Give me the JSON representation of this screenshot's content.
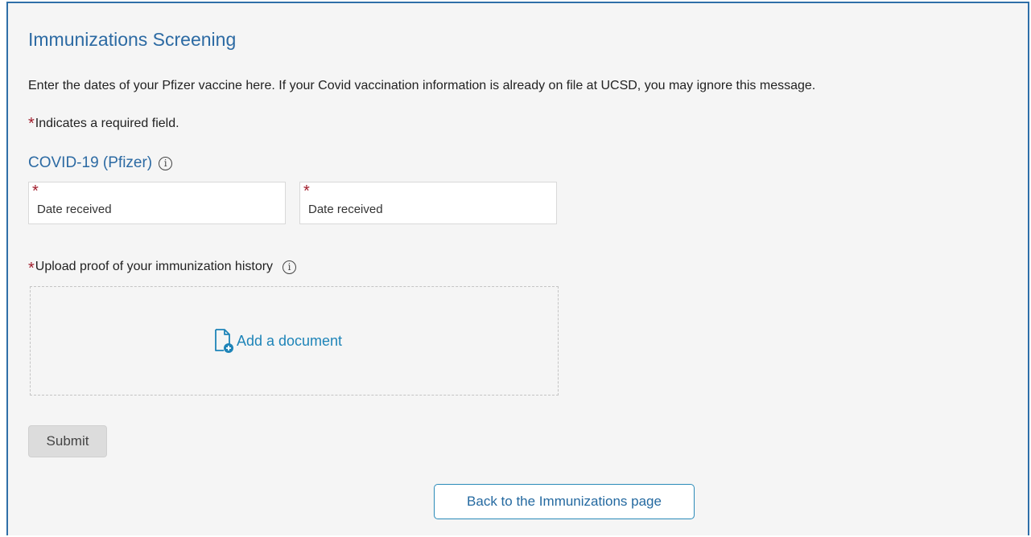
{
  "page": {
    "title": "Immunizations Screening",
    "intro": "Enter the dates of your Pfizer vaccine here. If your Covid vaccination information is already on file at UCSD, you may ignore this message.",
    "required_star": "*",
    "required_note": "Indicates a required field."
  },
  "vaccine": {
    "section_title": "COVID-19 (Pfizer)",
    "info_glyph": "i",
    "fields": [
      {
        "placeholder": "Date received",
        "value": ""
      },
      {
        "placeholder": "Date received",
        "value": ""
      }
    ]
  },
  "upload": {
    "label": "Upload proof of your immunization history",
    "add_document_label": "Add a document",
    "icon": "document-add-icon"
  },
  "actions": {
    "submit_label": "Submit",
    "back_label": "Back to the Immunizations page"
  },
  "colors": {
    "heading": "#2c6aa3",
    "required": "#a11d2c",
    "link": "#1e84b8",
    "panel_border": "#2f6fa8"
  }
}
